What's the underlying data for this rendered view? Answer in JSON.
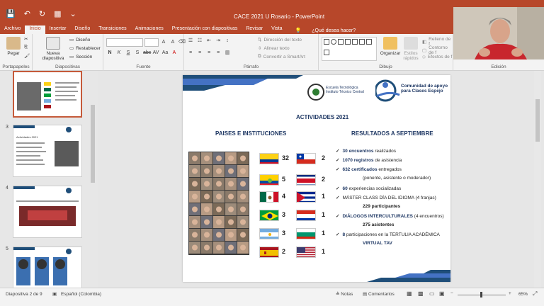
{
  "window": {
    "title": "CACE 2021 U Rosario  -  PowerPoint"
  },
  "ribbon_tabs": [
    "Archivo",
    "Inicio",
    "Insertar",
    "Diseño",
    "Transiciones",
    "Animaciones",
    "Presentación con diapositivas",
    "Revisar",
    "Vista"
  ],
  "tell_me": "¿Qué desea hacer?",
  "groups": {
    "clipboard": "Portapapeles",
    "slides": "Diapositivas",
    "font": "Fuente",
    "paragraph": "Párrafo",
    "drawing": "Dibujo",
    "editing": "Edición"
  },
  "buttons": {
    "paste": "Pegar",
    "new_slide": "Nueva diapositiva",
    "layout": "Diseño",
    "reset": "Restablecer",
    "section": "Sección",
    "text_direction": "Dirección del texto",
    "align_text": "Alinear texto",
    "smartart": "Convertir a SmartArt",
    "arrange": "Organizar",
    "quick_styles": "Estilos rápidos",
    "shape_fill": "Relleno de f",
    "shape_outline": "Contorno de f",
    "shape_effects": "Efectos de f"
  },
  "thumbnails": [
    {
      "num": "3",
      "title": "Actividades 2021"
    },
    {
      "num": "4",
      "title": ""
    },
    {
      "num": "5",
      "title": ""
    }
  ],
  "slide": {
    "logo1": "Escuela Tecnológica Instituto Técnico Central",
    "logo2": "Comunidad de apoyo para Clases Espejo",
    "title": "ACTIVIDADES 2021",
    "left_header": "PAISES E INSTITUCIONES",
    "right_header": "RESULTADOS A SEPTIEMBRE",
    "flags_left": [
      {
        "name": "colombia",
        "count": "32"
      },
      {
        "name": "ecuador",
        "count": "5"
      },
      {
        "name": "mexico",
        "count": "4"
      },
      {
        "name": "brazil",
        "count": "3"
      },
      {
        "name": "argentina",
        "count": "3"
      },
      {
        "name": "spain",
        "count": "2"
      }
    ],
    "flags_right": [
      {
        "name": "chile",
        "count": "2"
      },
      {
        "name": "costa-rica",
        "count": "2"
      },
      {
        "name": "cuba",
        "count": "1"
      },
      {
        "name": "paraguay",
        "count": "1"
      },
      {
        "name": "bulgaria",
        "count": "1"
      },
      {
        "name": "usa",
        "count": "1"
      }
    ],
    "results": [
      {
        "bold": "30 encuentros",
        "rest": " realizados"
      },
      {
        "bold": "1070 registros",
        "rest": " de asistencia"
      },
      {
        "bold": "632 certificados",
        "rest": " entregados"
      },
      {
        "bold": "",
        "rest": "(ponente, asistente o moderador)"
      },
      {
        "bold": "60",
        "rest": " experiencias socializadas"
      },
      {
        "bold": "",
        "rest": "MÁSTER CLASS DÍA DEL IDIOMA (4 franjas)"
      },
      {
        "bold": "",
        "rest": "229 participantes"
      },
      {
        "bold": "DIÁLOGOS INTERCULTURALES",
        "rest": " (4 encuentros)"
      },
      {
        "bold": "",
        "rest": "275 asistentes"
      },
      {
        "bold": "8",
        "rest": " participaciones en la TERTULIA ACADÉMICA"
      },
      {
        "bold": "",
        "rest": "VIRTUAL TAV"
      }
    ]
  },
  "status": {
    "slide_info": "Diapositiva 2 de 9",
    "language": "Español (Colombia)",
    "notes": "Notas",
    "comments": "Comentarios",
    "zoom": "65%"
  },
  "colors": {
    "accent": "#b7472a",
    "navy": "#1f3864"
  }
}
